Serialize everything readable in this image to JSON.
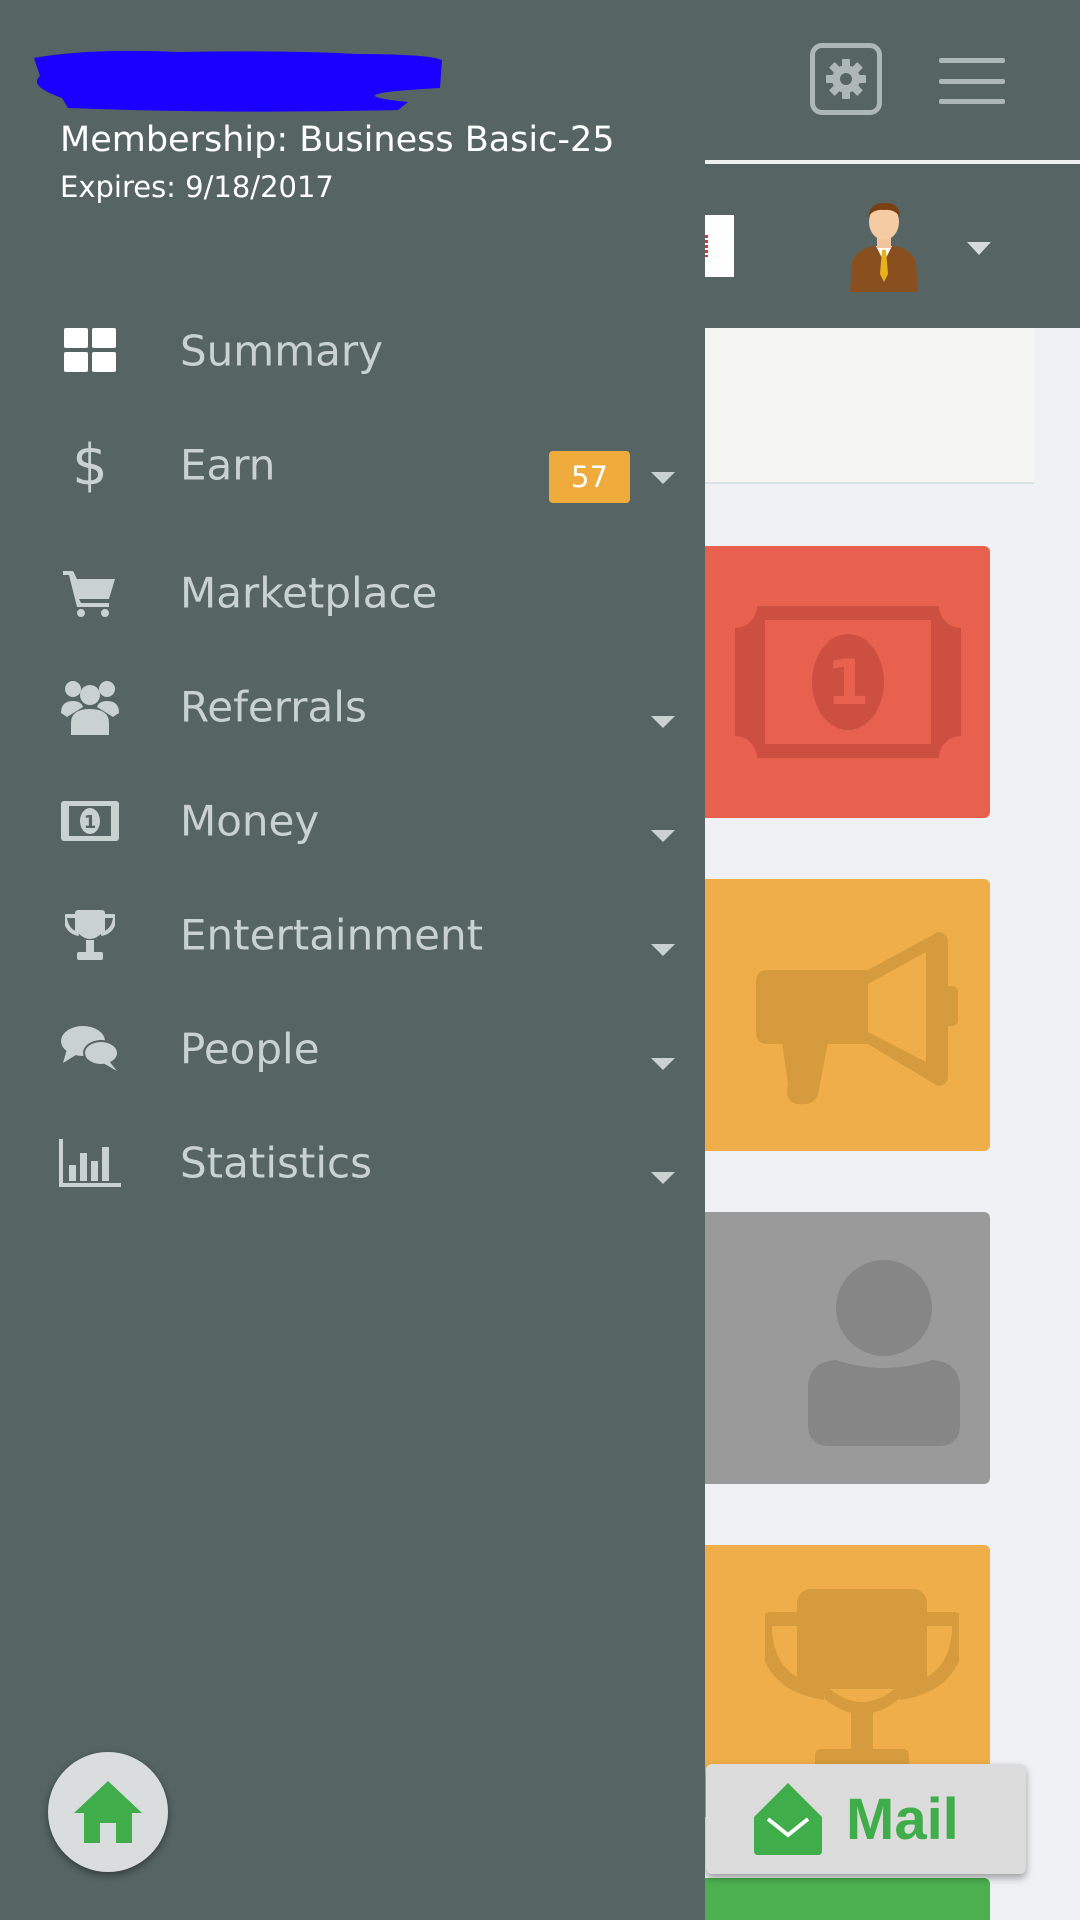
{
  "header": {
    "membership": "Membership: Business Basic-25",
    "expires": "Expires: 9/18/2017"
  },
  "nav": {
    "items": [
      {
        "label": "Summary",
        "icon": "grid-icon",
        "expandable": false
      },
      {
        "label": "Earn",
        "icon": "dollar-icon",
        "expandable": true,
        "badge": "57"
      },
      {
        "label": "Marketplace",
        "icon": "cart-icon",
        "expandable": false
      },
      {
        "label": "Referrals",
        "icon": "users-icon",
        "expandable": true
      },
      {
        "label": "Money",
        "icon": "money-icon",
        "expandable": true
      },
      {
        "label": "Entertainment",
        "icon": "trophy-icon",
        "expandable": true
      },
      {
        "label": "People",
        "icon": "chat-icon",
        "expandable": true
      },
      {
        "label": "Statistics",
        "icon": "bar-chart-icon",
        "expandable": true
      }
    ]
  },
  "mail": {
    "label": "Mail"
  },
  "colors": {
    "drawer": "#566464",
    "accent_badge": "#efab3c",
    "tile_red": "#e8614f",
    "tile_yellow": "#efae4a",
    "tile_gray": "#9a9a9a",
    "mail_green": "#3fae4a",
    "redaction": "#1a00ff"
  }
}
